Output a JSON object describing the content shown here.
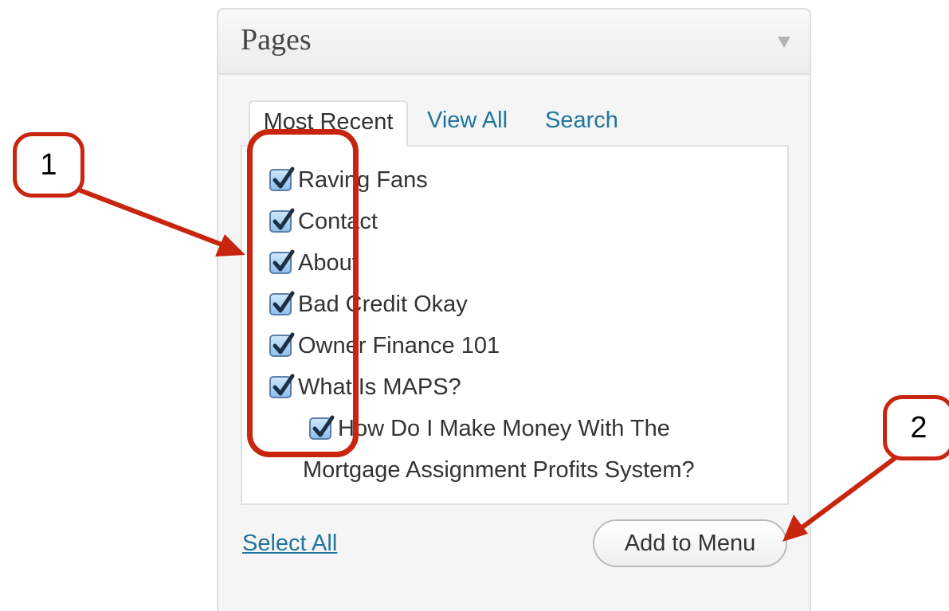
{
  "panel": {
    "title": "Pages",
    "tabs": [
      {
        "label": "Most Recent",
        "active": true
      },
      {
        "label": "View All",
        "active": false
      },
      {
        "label": "Search",
        "active": false
      }
    ],
    "items": [
      {
        "label": "Raving Fans",
        "checked": true
      },
      {
        "label": "Contact",
        "checked": true
      },
      {
        "label": "About",
        "checked": true
      },
      {
        "label": "Bad Credit Okay",
        "checked": true
      },
      {
        "label": "Owner Finance 101",
        "checked": true
      },
      {
        "label": "What Is MAPS?",
        "checked": true
      },
      {
        "label": "How Do I Make Money With The",
        "label_cont": "Mortgage Assignment Profits System?",
        "checked": true,
        "child": true
      }
    ],
    "select_all": "Select All",
    "add_button": "Add to Menu"
  },
  "annotations": {
    "callout_1": "1",
    "callout_2": "2",
    "color": "#c8250f"
  },
  "colors": {
    "link": "#21759b",
    "checkbox": "#8ec0ef",
    "panel_bg": "#f5f5f5"
  }
}
